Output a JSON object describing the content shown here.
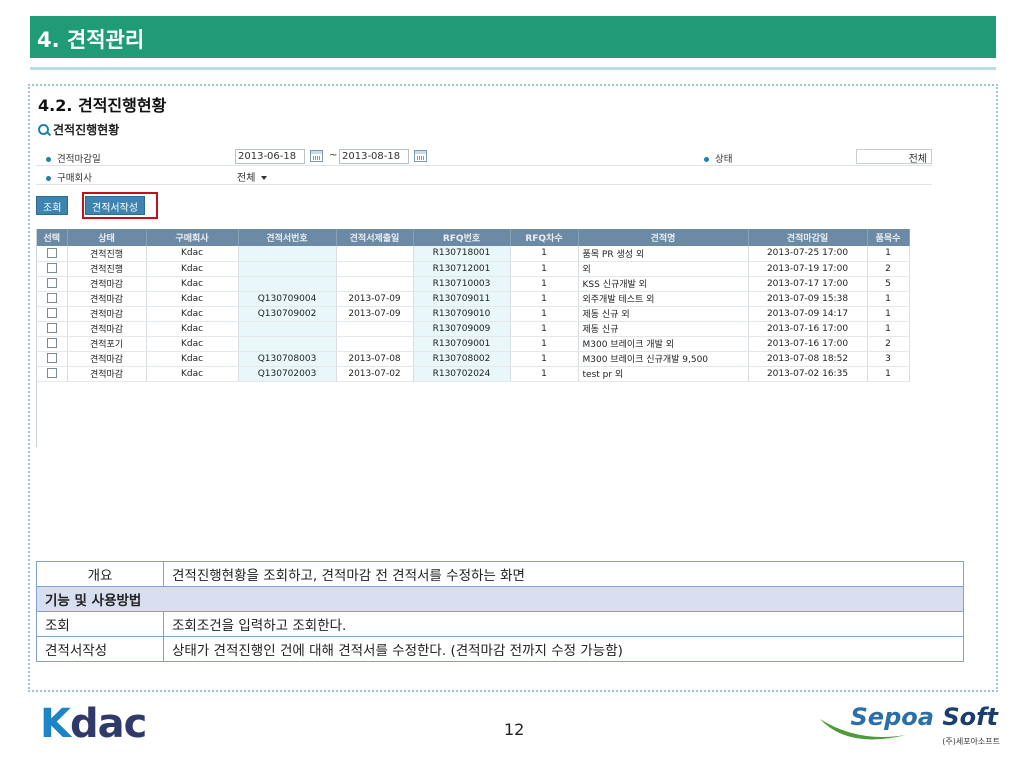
{
  "slide": {
    "header": "4. 견적관리",
    "section_title": "4.2. 견적진행현황",
    "page_number": "12"
  },
  "screen": {
    "title": "견적진행현황",
    "filters": {
      "deadline_label": "견적마감일",
      "date_from": "2013-06-18",
      "date_sep": "~",
      "date_to": "2013-08-18",
      "status_label": "상태",
      "status_value": "전체",
      "company_label": "구매회사",
      "company_value": "전체"
    },
    "buttons": {
      "search": "조회",
      "create_quote": "견적서작성"
    },
    "grid": {
      "columns": [
        "선택",
        "상태",
        "구매회사",
        "견적서번호",
        "견적서제출일",
        "RFQ번호",
        "RFQ차수",
        "견적명",
        "견적마감일",
        "품목수"
      ],
      "rows": [
        [
          "",
          "견적진행",
          "Kdac",
          "",
          "",
          "R130718001",
          "1",
          "품목 PR 생성 외",
          "2013-07-25 17:00",
          "1"
        ],
        [
          "",
          "견적진행",
          "Kdac",
          "",
          "",
          "R130712001",
          "1",
          "외",
          "2013-07-19 17:00",
          "2"
        ],
        [
          "",
          "견적마감",
          "Kdac",
          "",
          "",
          "R130710003",
          "1",
          "KSS 신규개발 외",
          "2013-07-17 17:00",
          "5"
        ],
        [
          "",
          "견적마감",
          "Kdac",
          "Q130709004",
          "2013-07-09",
          "R130709011",
          "1",
          "외주개발 테스트 외",
          "2013-07-09 15:38",
          "1"
        ],
        [
          "",
          "견적마감",
          "Kdac",
          "Q130709002",
          "2013-07-09",
          "R130709010",
          "1",
          "제동 신규 외",
          "2013-07-09 14:17",
          "1"
        ],
        [
          "",
          "견적마감",
          "Kdac",
          "",
          "",
          "R130709009",
          "1",
          "제동 신규",
          "2013-07-16 17:00",
          "1"
        ],
        [
          "",
          "견적포기",
          "Kdac",
          "",
          "",
          "R130709001",
          "1",
          "M300 브레이크 개발 외",
          "2013-07-16 17:00",
          "2"
        ],
        [
          "",
          "견적마감",
          "Kdac",
          "Q130708003",
          "2013-07-08",
          "R130708002",
          "1",
          "M300 브레이크 신규개발 9,500",
          "2013-07-08 18:52",
          "3"
        ],
        [
          "",
          "견적마감",
          "Kdac",
          "Q130702003",
          "2013-07-02",
          "R130702024",
          "1",
          "test pr 외",
          "2013-07-02 16:35",
          "1"
        ]
      ]
    }
  },
  "description": {
    "overview_label": "개요",
    "overview_text": "견적진행현황을 조회하고, 견적마감 전 견적서를 수정하는 화면",
    "usage_header": "기능 및 사용방법",
    "items": [
      {
        "label": "조회",
        "text": "조회조건을 입력하고 조회한다."
      },
      {
        "label": "견적서작성",
        "text": "상태가 견적진행인 건에 대해 견적서를 수정한다. (견적마감 전까지 수정 가능함)"
      }
    ]
  },
  "footer": {
    "logo_left": "Kdac",
    "logo_right_a": "Sepoa",
    "logo_right_b": "Soft",
    "logo_right_kor": "(주)세포아소프트"
  },
  "colors": {
    "header_green": "#1f9b78",
    "grid_header": "#6c8aa5",
    "button_blue": "#3d85b0",
    "highlight_red": "#c1121c"
  }
}
